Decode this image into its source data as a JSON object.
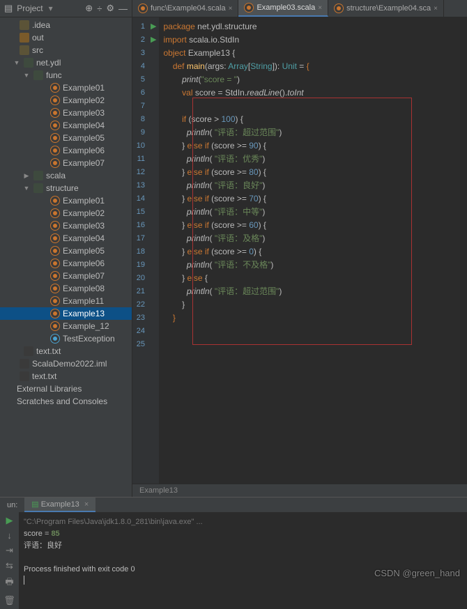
{
  "sidebar": {
    "title": "Project",
    "nodes": [
      {
        "indent": 4,
        "exp": "",
        "icon": "folder",
        "label": ".idea"
      },
      {
        "indent": 4,
        "exp": "",
        "icon": "folder orange",
        "label": "out"
      },
      {
        "indent": 4,
        "exp": "",
        "icon": "folder",
        "label": "src"
      },
      {
        "indent": 10,
        "exp": "▼",
        "icon": "pkg",
        "label": "net.ydl"
      },
      {
        "indent": 24,
        "exp": "▼",
        "icon": "pkg",
        "label": "func"
      },
      {
        "indent": 48,
        "exp": "",
        "icon": "scala",
        "label": "Example01"
      },
      {
        "indent": 48,
        "exp": "",
        "icon": "scala",
        "label": "Example02"
      },
      {
        "indent": 48,
        "exp": "",
        "icon": "scala",
        "label": "Example03"
      },
      {
        "indent": 48,
        "exp": "",
        "icon": "scala",
        "label": "Example04"
      },
      {
        "indent": 48,
        "exp": "",
        "icon": "scala",
        "label": "Example05"
      },
      {
        "indent": 48,
        "exp": "",
        "icon": "scala",
        "label": "Example06"
      },
      {
        "indent": 48,
        "exp": "",
        "icon": "scala",
        "label": "Example07"
      },
      {
        "indent": 24,
        "exp": "▶",
        "icon": "pkg",
        "label": "scala"
      },
      {
        "indent": 24,
        "exp": "▼",
        "icon": "pkg",
        "label": "structure"
      },
      {
        "indent": 48,
        "exp": "",
        "icon": "scala",
        "label": "Example01"
      },
      {
        "indent": 48,
        "exp": "",
        "icon": "scala",
        "label": "Example02"
      },
      {
        "indent": 48,
        "exp": "",
        "icon": "scala",
        "label": "Example03"
      },
      {
        "indent": 48,
        "exp": "",
        "icon": "scala",
        "label": "Example04"
      },
      {
        "indent": 48,
        "exp": "",
        "icon": "scala",
        "label": "Example05"
      },
      {
        "indent": 48,
        "exp": "",
        "icon": "scala",
        "label": "Example06"
      },
      {
        "indent": 48,
        "exp": "",
        "icon": "scala",
        "label": "Example07"
      },
      {
        "indent": 48,
        "exp": "",
        "icon": "scala",
        "label": "Example08"
      },
      {
        "indent": 48,
        "exp": "",
        "icon": "scala",
        "label": "Example11"
      },
      {
        "indent": 48,
        "exp": "",
        "icon": "scala",
        "label": "Example13",
        "sel": true
      },
      {
        "indent": 48,
        "exp": "",
        "icon": "scala",
        "label": "Example_12"
      },
      {
        "indent": 48,
        "exp": "",
        "icon": "scala blue",
        "label": "TestException"
      },
      {
        "indent": 10,
        "exp": "",
        "icon": "txt",
        "label": "text.txt"
      },
      {
        "indent": 4,
        "exp": "",
        "icon": "txt",
        "label": "ScalaDemo2022.iml"
      },
      {
        "indent": 4,
        "exp": "",
        "icon": "txt",
        "label": "text.txt"
      },
      {
        "indent": 0,
        "exp": "",
        "icon": "",
        "label": "External Libraries"
      },
      {
        "indent": 0,
        "exp": "",
        "icon": "",
        "label": "Scratches and Consoles"
      }
    ]
  },
  "tabs": [
    {
      "icon": "scala",
      "label": "func\\Example04.scala",
      "active": false
    },
    {
      "icon": "scala",
      "label": "Example03.scala",
      "active": true
    },
    {
      "icon": "scala",
      "label": "structure\\Example04.sca",
      "active": false
    }
  ],
  "code": {
    "lines": [
      {
        "n": 1,
        "html": "<span class='kw'>package</span> net.ydl.structure"
      },
      {
        "n": 2,
        "html": "<span class='kw'>import</span> scala.io.StdIn"
      },
      {
        "n": 3,
        "run": "▶",
        "html": "<span class='kw'>object</span> Example13 {"
      },
      {
        "n": 4,
        "run": "▶",
        "html": "    <span class='kw'>def</span> <span class='yel'>main</span>(args: <span class='typ'>Array</span>[<span class='typ'>String</span>]): <span class='typ'>Unit</span> = <span class='kw'>{</span>"
      },
      {
        "n": 5,
        "html": "        <span class='fn'>print</span>(<span class='str'>\"score = \"</span>)"
      },
      {
        "n": 6,
        "html": "        <span class='kw'>val</span> score = StdIn.<span class='fn'>readLine</span>().<span class='fn'>toInt</span>"
      },
      {
        "n": 7,
        "html": ""
      },
      {
        "n": 8,
        "html": "        <span class='kw'>if</span> (score &gt; <span class='num'>100</span>) {"
      },
      {
        "n": 9,
        "html": "          <span class='fn'>println</span>( <span class='str'>\"评语：超过范围\"</span>)"
      },
      {
        "n": 10,
        "html": "        } <span class='kw'>else if</span> (score &gt;= <span class='num'>90</span>) {"
      },
      {
        "n": 11,
        "html": "          <span class='fn'>println</span>( <span class='str'>\"评语：优秀\"</span>)"
      },
      {
        "n": 12,
        "html": "        } <span class='kw'>else if</span> (score &gt;= <span class='num'>80</span>) {"
      },
      {
        "n": 13,
        "html": "          <span class='fn'>println</span>( <span class='str'>\"评语：良好\"</span>)"
      },
      {
        "n": 14,
        "html": "        } <span class='kw'>else if</span> (score &gt;= <span class='num'>70</span>) {"
      },
      {
        "n": 15,
        "html": "          <span class='fn'>println</span>( <span class='str'>\"评语：中等\"</span>)"
      },
      {
        "n": 16,
        "html": "        } <span class='kw'>else if</span> (score &gt;= <span class='num'>60</span>) {"
      },
      {
        "n": 17,
        "html": "          <span class='fn'>println</span>( <span class='str'>\"评语：及格\"</span>)"
      },
      {
        "n": 18,
        "html": "        } <span class='kw'>else if</span> (score &gt;= <span class='num'>0</span>) {"
      },
      {
        "n": 19,
        "html": "          <span class='fn'>println</span>( <span class='str'>\"评语：不及格\"</span>)"
      },
      {
        "n": 20,
        "html": "        } <span class='kw'>else</span> {"
      },
      {
        "n": 21,
        "html": "          <span class='fn'>println</span>( <span class='str'>\"评语：超过范围\"</span>)"
      },
      {
        "n": 22,
        "html": "        }"
      },
      {
        "n": 23,
        "html": "    <span class='kw'>}</span>"
      },
      {
        "n": 24,
        "html": ""
      },
      {
        "n": 25,
        "html": ""
      }
    ]
  },
  "breadcrumb": "Example13",
  "run": {
    "tab_prefix": "un:",
    "tab_name": "Example13",
    "cmd": "\"C:\\Program Files\\Java\\jdk1.8.0_281\\bin\\java.exe\" ...",
    "prompt": "score = ",
    "input": "85",
    "out1": "评语：良好",
    "exit": "Process finished with exit code 0"
  },
  "watermark": "CSDN @green_hand"
}
